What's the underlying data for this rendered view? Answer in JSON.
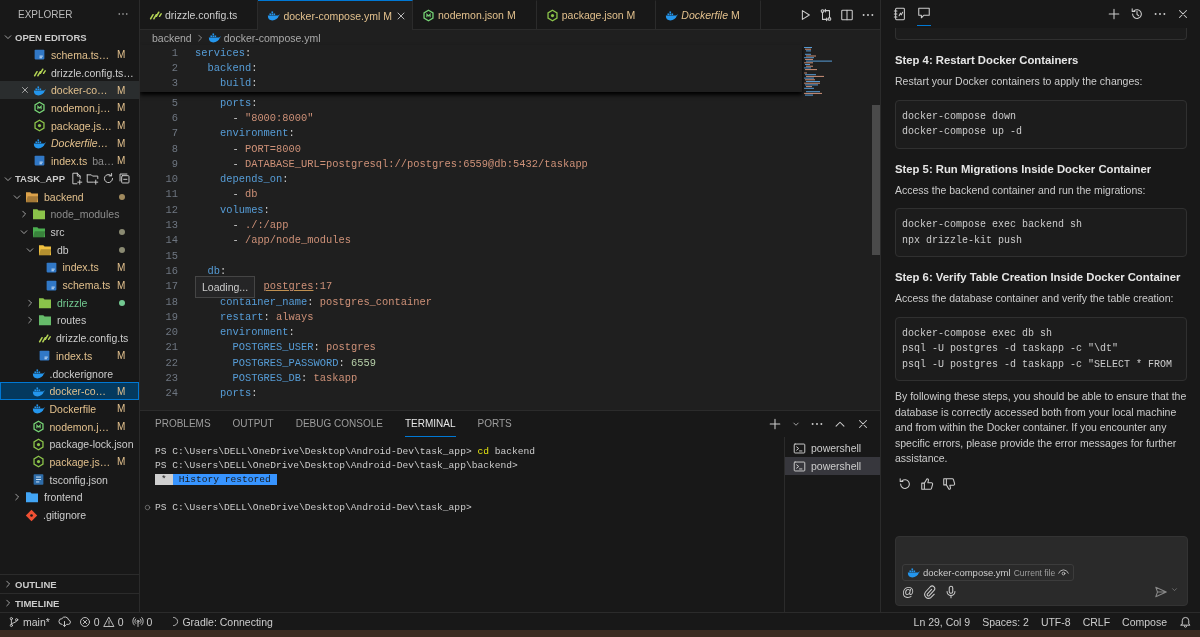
{
  "explorer": {
    "title": "EXPLORER",
    "open_editors": {
      "title": "OPEN EDITORS",
      "expanded": true,
      "items": [
        {
          "name": "schema.ts…",
          "kind": "ts",
          "modified": true,
          "status": "M",
          "selected": false,
          "preview": false
        },
        {
          "name": "drizzle.config.ts…",
          "kind": "drizzle",
          "modified": false,
          "selected": false,
          "preview": false
        },
        {
          "name": "docker-co…",
          "kind": "docker",
          "modified": true,
          "status": "M",
          "selected": true,
          "preview": false
        },
        {
          "name": "nodemon.j…",
          "kind": "nodemon",
          "modified": true,
          "status": "M",
          "selected": false,
          "preview": false
        },
        {
          "name": "package.js…",
          "kind": "npm",
          "modified": true,
          "status": "M",
          "selected": false,
          "preview": false
        },
        {
          "name": "Dockerfile…",
          "kind": "docker",
          "modified": true,
          "status": "M",
          "selected": false,
          "preview": true
        },
        {
          "name": "index.ts",
          "description": "ba…",
          "kind": "ts",
          "modified": true,
          "status": "M",
          "selected": false,
          "preview": false
        }
      ]
    },
    "project": {
      "title": "TASK_APP",
      "expanded": true,
      "tree": [
        {
          "name": "backend",
          "kind": "folder",
          "modified": true,
          "untracked": false,
          "ignored": false,
          "dot": true,
          "expanded": true,
          "selected": false,
          "children": [
            {
              "name": "node_modules",
              "kind": "folder-node",
              "modified": false,
              "untracked": false,
              "ignored": true,
              "expanded": false,
              "selected": false
            },
            {
              "name": "src",
              "kind": "folder-src",
              "modified": false,
              "untracked": false,
              "ignored": false,
              "dot": true,
              "expanded": true,
              "selected": false,
              "children": [
                {
                  "name": "db",
                  "kind": "folder-db",
                  "modified": false,
                  "untracked": false,
                  "ignored": false,
                  "dot": true,
                  "expanded": true,
                  "selected": false,
                  "children": [
                    {
                      "name": "index.ts",
                      "kind": "ts",
                      "modified": true,
                      "untracked": false,
                      "ignored": false,
                      "status": "M",
                      "selected": false
                    },
                    {
                      "name": "schema.ts",
                      "kind": "ts",
                      "modified": true,
                      "untracked": false,
                      "ignored": false,
                      "status": "M",
                      "selected": false
                    }
                  ]
                },
                {
                  "name": "drizzle",
                  "kind": "folder-drizzle",
                  "modified": false,
                  "untracked": true,
                  "ignored": false,
                  "dot": true,
                  "expanded": false,
                  "selected": false
                },
                {
                  "name": "routes",
                  "kind": "folder-routes",
                  "modified": false,
                  "untracked": false,
                  "ignored": false,
                  "expanded": false,
                  "selected": false
                },
                {
                  "name": "drizzle.config.ts",
                  "kind": "drizzle",
                  "modified": false,
                  "untracked": false,
                  "ignored": false,
                  "selected": false
                },
                {
                  "name": "index.ts",
                  "kind": "ts",
                  "modified": true,
                  "untracked": false,
                  "ignored": false,
                  "status": "M",
                  "selected": false
                }
              ]
            },
            {
              "name": ".dockerignore",
              "kind": "docker",
              "modified": false,
              "untracked": false,
              "ignored": false,
              "selected": false
            },
            {
              "name": "docker-co…",
              "kind": "docker",
              "modified": true,
              "untracked": false,
              "ignored": false,
              "status": "M",
              "selected": true
            },
            {
              "name": "Dockerfile",
              "kind": "docker",
              "modified": true,
              "untracked": false,
              "ignored": false,
              "status": "M",
              "selected": false
            },
            {
              "name": "nodemon.j…",
              "kind": "nodemon",
              "modified": true,
              "untracked": false,
              "ignored": false,
              "status": "M",
              "selected": false
            },
            {
              "name": "package-lock.json",
              "kind": "npm",
              "modified": false,
              "untracked": false,
              "ignored": false,
              "selected": false
            },
            {
              "name": "package.js…",
              "kind": "npm",
              "modified": true,
              "untracked": false,
              "ignored": false,
              "status": "M",
              "selected": false
            },
            {
              "name": "tsconfig.json",
              "kind": "tsconfig",
              "modified": false,
              "untracked": false,
              "ignored": false,
              "selected": false
            }
          ]
        },
        {
          "name": "frontend",
          "kind": "folder-frontend",
          "modified": false,
          "untracked": false,
          "ignored": false,
          "expanded": false,
          "selected": false
        },
        {
          "name": ".gitignore",
          "kind": "git",
          "modified": false,
          "untracked": false,
          "ignored": false,
          "selected": false
        }
      ]
    },
    "sections": [
      {
        "title": "OUTLINE",
        "expanded": false
      },
      {
        "title": "TIMELINE",
        "expanded": false
      }
    ]
  },
  "editor": {
    "tabs": [
      {
        "label": "drizzle.config.ts",
        "kind": "drizzle",
        "modified": false,
        "selected": false,
        "preview": false
      },
      {
        "label": "docker-compose.yml",
        "kind": "docker",
        "modified": true,
        "status": "M",
        "selected": true,
        "preview": false
      },
      {
        "label": "nodemon.json",
        "kind": "nodemon",
        "modified": true,
        "status": "M",
        "selected": false,
        "preview": false
      },
      {
        "label": "package.json",
        "kind": "npm",
        "modified": true,
        "status": "M",
        "selected": false,
        "preview": false
      },
      {
        "label": "Dockerfile",
        "kind": "docker",
        "modified": true,
        "status": "M",
        "selected": false,
        "preview": true
      }
    ],
    "breadcrumb": [
      {
        "label": "backend"
      },
      {
        "label": "docker-compose.yml",
        "kind": "docker"
      }
    ],
    "sticky_lines": [
      {
        "n": "1",
        "tokens": [
          {
            "text": "services",
            "kind": "key"
          },
          {
            "text": ":",
            "kind": "punct"
          }
        ]
      },
      {
        "n": "2",
        "tokens": [
          {
            "text": "  backend",
            "kind": "key"
          },
          {
            "text": ":",
            "kind": "punct"
          }
        ]
      },
      {
        "n": "3",
        "tokens": [
          {
            "text": "    build",
            "kind": "key"
          },
          {
            "text": ":",
            "kind": "punct"
          }
        ]
      }
    ],
    "lines": [
      {
        "n": "5",
        "tokens": [
          {
            "text": "    ports",
            "kind": "key"
          },
          {
            "text": ":",
            "kind": "punct"
          }
        ]
      },
      {
        "n": "6",
        "tokens": [
          {
            "text": "      - ",
            "kind": "punct"
          },
          {
            "text": "\"8000:8000\"",
            "kind": "string"
          }
        ]
      },
      {
        "n": "7",
        "tokens": [
          {
            "text": "    environment",
            "kind": "key"
          },
          {
            "text": ":",
            "kind": "punct"
          }
        ]
      },
      {
        "n": "8",
        "tokens": [
          {
            "text": "      - ",
            "kind": "punct"
          },
          {
            "text": "PORT=8000",
            "kind": "string"
          }
        ]
      },
      {
        "n": "9",
        "tokens": [
          {
            "text": "      - ",
            "kind": "punct"
          },
          {
            "text": "DATABASE_URL=postgresql://postgres:6559@db:5432/taskapp",
            "kind": "string"
          }
        ]
      },
      {
        "n": "10",
        "tokens": [
          {
            "text": "    depends_on",
            "kind": "key"
          },
          {
            "text": ":",
            "kind": "punct"
          }
        ]
      },
      {
        "n": "11",
        "tokens": [
          {
            "text": "      - ",
            "kind": "punct"
          },
          {
            "text": "db",
            "kind": "string"
          }
        ]
      },
      {
        "n": "12",
        "tokens": [
          {
            "text": "    volumes",
            "kind": "key"
          },
          {
            "text": ":",
            "kind": "punct"
          }
        ]
      },
      {
        "n": "13",
        "tokens": [
          {
            "text": "      - ",
            "kind": "punct"
          },
          {
            "text": "./:/app",
            "kind": "string"
          }
        ]
      },
      {
        "n": "14",
        "tokens": [
          {
            "text": "      - ",
            "kind": "punct"
          },
          {
            "text": "/app/node_modules",
            "kind": "string"
          }
        ]
      },
      {
        "n": "15"
      },
      {
        "n": "16",
        "tokens": [
          {
            "text": "  db",
            "kind": "key"
          },
          {
            "text": ":",
            "kind": "punct"
          }
        ]
      },
      {
        "n": "17",
        "tokens": [
          {
            "text": "           postgres",
            "kind": "underlined"
          },
          {
            "text": ":17",
            "kind": "string"
          }
        ],
        "hover": "Loading..."
      },
      {
        "n": "18",
        "tokens": [
          {
            "text": "    container_name",
            "kind": "key"
          },
          {
            "text": ": ",
            "kind": "punct"
          },
          {
            "text": "postgres_container",
            "kind": "string"
          }
        ]
      },
      {
        "n": "19",
        "tokens": [
          {
            "text": "    restart",
            "kind": "key"
          },
          {
            "text": ": ",
            "kind": "punct"
          },
          {
            "text": "always",
            "kind": "string"
          }
        ]
      },
      {
        "n": "20",
        "tokens": [
          {
            "text": "    environment",
            "kind": "key"
          },
          {
            "text": ":",
            "kind": "punct"
          }
        ]
      },
      {
        "n": "21",
        "tokens": [
          {
            "text": "      POSTGRES_USER",
            "kind": "key"
          },
          {
            "text": ": ",
            "kind": "punct"
          },
          {
            "text": "postgres",
            "kind": "string"
          }
        ]
      },
      {
        "n": "22",
        "tokens": [
          {
            "text": "      POSTGRES_PASSWORD",
            "kind": "key"
          },
          {
            "text": ": ",
            "kind": "punct"
          },
          {
            "text": "6559",
            "kind": "number"
          }
        ]
      },
      {
        "n": "23",
        "tokens": [
          {
            "text": "      POSTGRES_DB",
            "kind": "key"
          },
          {
            "text": ": ",
            "kind": "punct"
          },
          {
            "text": "taskapp",
            "kind": "string"
          }
        ]
      },
      {
        "n": "24",
        "tokens": [
          {
            "text": "    ports",
            "kind": "key"
          },
          {
            "text": ":",
            "kind": "punct"
          }
        ]
      }
    ]
  },
  "panel": {
    "tabs": [
      {
        "label": "PROBLEMS",
        "selected": false
      },
      {
        "label": "OUTPUT",
        "selected": false
      },
      {
        "label": "DEBUG CONSOLE",
        "selected": false
      },
      {
        "label": "TERMINAL",
        "selected": true
      },
      {
        "label": "PORTS",
        "selected": false
      }
    ],
    "terminal_lines": [
      {
        "kind": "prompt",
        "prompt": "PS C:\\Users\\DELL\\OneDrive\\Desktop\\Android-Dev\\task_app>",
        "command": "cd",
        "args": "backend",
        "decorated": false
      },
      {
        "kind": "prompt",
        "prompt": "PS C:\\Users\\DELL\\OneDrive\\Desktop\\Android-Dev\\task_app\\backend>",
        "decorated": false
      },
      {
        "kind": "notice",
        "mark": "*",
        "text": "History restored"
      },
      {
        "kind": "blank"
      },
      {
        "kind": "prompt",
        "prompt": "PS C:\\Users\\DELL\\OneDrive\\Desktop\\Android-Dev\\task_app>",
        "decorated": true
      }
    ],
    "sessions": [
      {
        "label": "powershell",
        "selected": false
      },
      {
        "label": "powershell",
        "selected": true
      }
    ]
  },
  "chat": {
    "blocks": [
      {
        "kind": "heading",
        "text": "Step 4: Restart Docker Containers"
      },
      {
        "kind": "paragraph",
        "text": "Restart your Docker containers to apply the changes:"
      },
      {
        "kind": "code",
        "lines": [
          "docker-compose down",
          "docker-compose up -d"
        ]
      },
      {
        "kind": "heading",
        "text": "Step 5: Run Migrations Inside Docker Container"
      },
      {
        "kind": "paragraph",
        "text": "Access the backend container and run the migrations:"
      },
      {
        "kind": "code",
        "lines": [
          "docker-compose exec backend sh",
          "npx drizzle-kit push"
        ]
      },
      {
        "kind": "heading",
        "text": "Step 6: Verify Table Creation Inside Docker Container"
      },
      {
        "kind": "paragraph",
        "text": "Access the database container and verify the table creation:"
      },
      {
        "kind": "code",
        "lines": [
          "docker-compose exec db sh",
          "psql -U postgres -d taskapp -c \"\\dt\"",
          "psql -U postgres -d taskapp -c \"SELECT * FROM"
        ]
      },
      {
        "kind": "paragraph",
        "text": "By following these steps, you should be able to ensure that the database is correctly accessed both from your local machine and from within the Docker container. If you encounter any specific errors, please provide the error messages for further assistance."
      }
    ],
    "input": {
      "mention": "@",
      "context": {
        "file": "docker-compose.yml",
        "note": "Current file"
      }
    }
  },
  "status_bar": {
    "branch": "main*",
    "errors": "0",
    "warnings": "0",
    "ports": "0",
    "task": "Gradle: Connecting",
    "right": [
      "Ln 29, Col 9",
      "Spaces: 2",
      "UTF-8",
      "CRLF",
      "Compose"
    ]
  }
}
